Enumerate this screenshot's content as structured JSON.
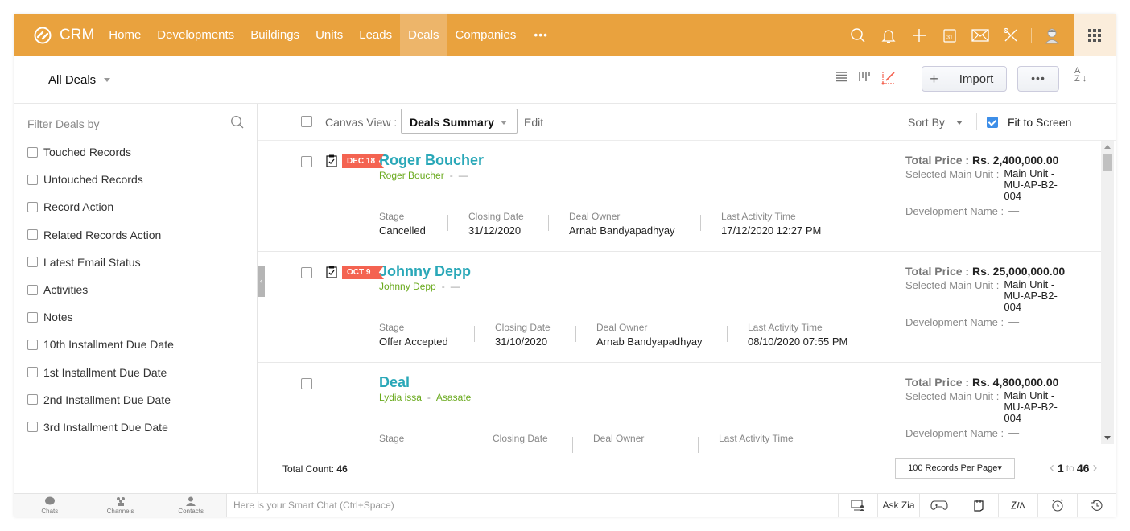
{
  "nav": {
    "brand": "CRM",
    "items": [
      {
        "label": "Home",
        "active": false
      },
      {
        "label": "Developments",
        "active": false
      },
      {
        "label": "Buildings",
        "active": false
      },
      {
        "label": "Units",
        "active": false
      },
      {
        "label": "Leads",
        "active": false
      },
      {
        "label": "Deals",
        "active": true
      },
      {
        "label": "Companies",
        "active": false
      }
    ],
    "more": "•••",
    "icons": [
      "search-icon",
      "bell-icon",
      "plus-icon",
      "calendar-icon",
      "mail-icon",
      "tools-icon",
      "avatar-icon",
      "apps-grid-icon"
    ],
    "calendar_day": "31",
    "accent": "#e9a23e"
  },
  "subheader": {
    "view_name": "All Deals",
    "import_label": "Import",
    "more_label": "•••",
    "sort_az_top": "A",
    "sort_az_bottom": "Z"
  },
  "sidebar": {
    "title": "Filter Deals by",
    "filters": [
      "Touched Records",
      "Untouched Records",
      "Record Action",
      "Related Records Action",
      "Latest Email Status",
      "Activities",
      "Notes",
      "10th Installment Due Date",
      "1st Installment Due Date",
      "2nd Installment Due Date",
      "3rd Installment Due Date"
    ]
  },
  "canvasbar": {
    "label": "Canvas View :",
    "selected": "Deals Summary",
    "edit": "Edit",
    "sort_by": "Sort By",
    "fit_to_screen": "Fit to Screen",
    "fit_checked": true
  },
  "labels": {
    "stage": "Stage",
    "closing_date": "Closing Date",
    "deal_owner": "Deal Owner",
    "last_activity": "Last Activity Time",
    "total_price": "Total Price :",
    "selected_unit": "Selected Main Unit :",
    "development": "Development Name :"
  },
  "records": [
    {
      "tag": "DEC 18",
      "title": "Roger Boucher",
      "contact": "Roger Boucher",
      "account": "—",
      "stage": "Cancelled",
      "closing_date": "31/12/2020",
      "owner": "Arnab Bandyapadhyay",
      "last_activity": "17/12/2020 12:27 PM",
      "total_price": "Rs. 2,400,000.00",
      "unit_lines": [
        "Main Unit -",
        "MU-AP-B2-",
        "004"
      ],
      "development": "—"
    },
    {
      "tag": "OCT 9",
      "title": "Johnny Depp",
      "contact": "Johnny Depp",
      "account": "—",
      "stage": "Offer Accepted",
      "closing_date": "31/10/2020",
      "owner": "Arnab Bandyapadhyay",
      "last_activity": "08/10/2020 07:55 PM",
      "total_price": "Rs. 25,000,000.00",
      "unit_lines": [
        "Main Unit -",
        "MU-AP-B2-",
        "004"
      ],
      "development": "—"
    },
    {
      "tag": "",
      "title": "Deal",
      "contact": "Lydia issa",
      "account": "Asasate",
      "stage": "",
      "closing_date": "",
      "owner": "",
      "last_activity": "",
      "total_price": "Rs. 4,800,000.00",
      "unit_lines": [
        "Main Unit -",
        "MU-AP-B2-",
        "004"
      ],
      "development": "—"
    }
  ],
  "footer": {
    "total_label": "Total Count:",
    "total_value": "46",
    "per_page": "100 Records Per Page▾",
    "page_from": "1",
    "page_to_label": "to",
    "page_to": "46"
  },
  "bottombar": {
    "left": [
      {
        "label": "Chats",
        "icon": "chat-icon"
      },
      {
        "label": "Channels",
        "icon": "channels-icon"
      },
      {
        "label": "Contacts",
        "icon": "contacts-icon"
      }
    ],
    "smartchat_placeholder": "Here is your Smart Chat (Ctrl+Space)",
    "ask_zia": "Ask Zia"
  }
}
